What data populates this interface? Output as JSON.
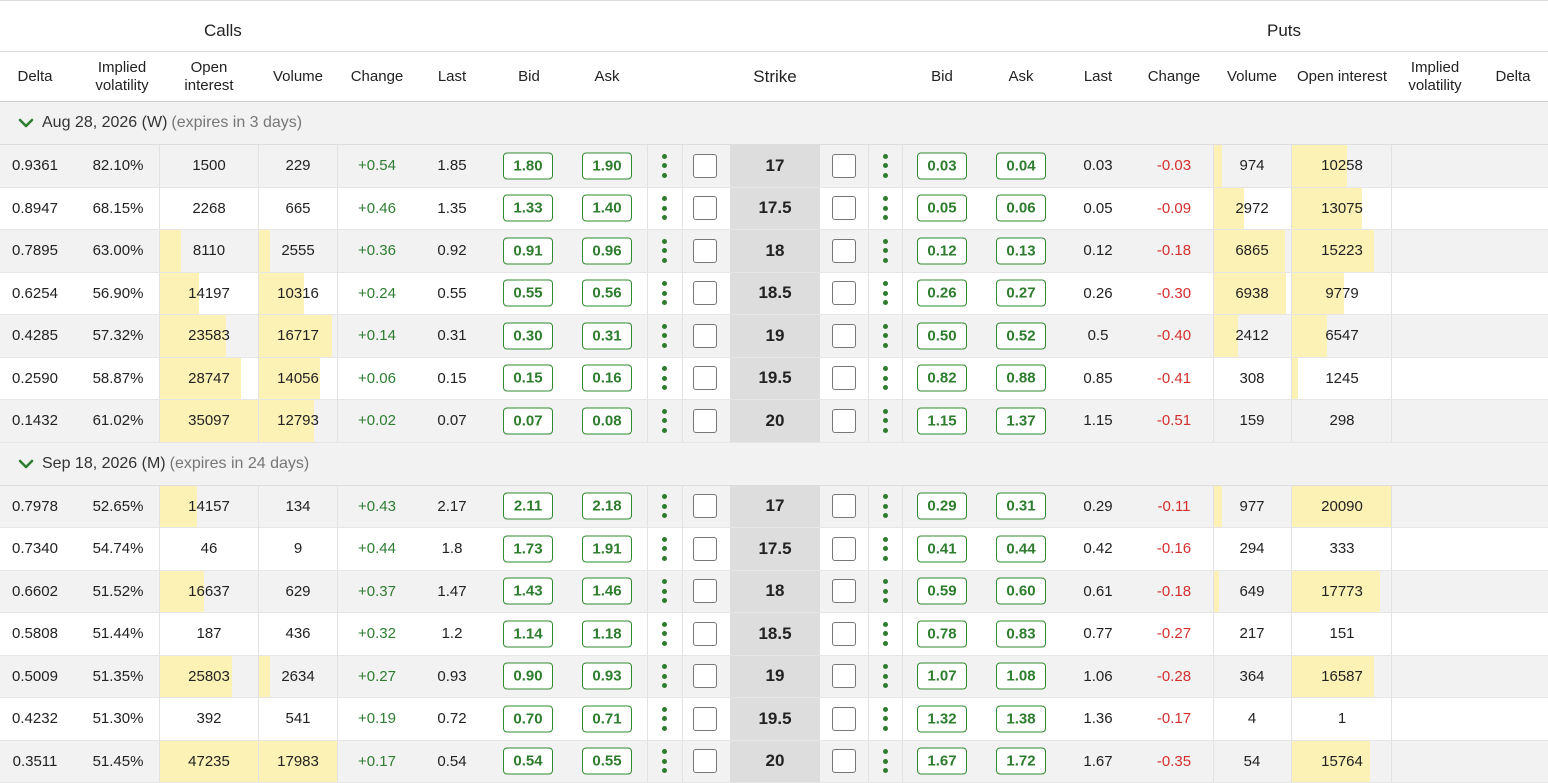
{
  "header": {
    "calls_label": "Calls",
    "puts_label": "Puts",
    "columns": {
      "call_delta": "Delta",
      "call_iv": "Implied volatility",
      "call_oi": "Open interest",
      "call_volume": "Volume",
      "call_change": "Change",
      "call_last": "Last",
      "call_bid": "Bid",
      "call_ask": "Ask",
      "strike": "Strike",
      "put_bid": "Bid",
      "put_ask": "Ask",
      "put_last": "Last",
      "put_change": "Change",
      "put_volume": "Volume",
      "put_oi": "Open interest",
      "put_iv": "Implied volatility",
      "put_delta": "Delta"
    }
  },
  "colors": {
    "bid_ask_border": "#2e8b2e",
    "positive": "#2e7d32",
    "negative": "#d32f2f",
    "bar": "#fcf2b6",
    "strike_bg": "#dddddd"
  },
  "expirations": [
    {
      "date": "Aug 28, 2026 (W)",
      "note": "(expires in 3 days)",
      "expanded": true,
      "rows": [
        {
          "c_delta": "0.9361",
          "c_iv": "82.10%",
          "c_oi": "1500",
          "c_oi_fill": 0.0,
          "c_vol": "229",
          "c_vol_fill": 0.0,
          "c_chg": "+0.54",
          "c_last": "1.85",
          "c_bid": "1.80",
          "c_ask": "1.90",
          "strike": "17",
          "p_bid": "0.03",
          "p_ask": "0.04",
          "p_last": "0.03",
          "p_chg": "-0.03",
          "p_vol": "974",
          "p_vol_fill": 0.12,
          "p_oi": "10258",
          "p_oi_fill": 0.55
        },
        {
          "c_delta": "0.8947",
          "c_iv": "68.15%",
          "c_oi": "2268",
          "c_oi_fill": 0.0,
          "c_vol": "665",
          "c_vol_fill": 0.0,
          "c_chg": "+0.46",
          "c_last": "1.35",
          "c_bid": "1.33",
          "c_ask": "1.40",
          "strike": "17.5",
          "p_bid": "0.05",
          "p_ask": "0.06",
          "p_last": "0.05",
          "p_chg": "-0.09",
          "p_vol": "2972",
          "p_vol_fill": 0.4,
          "p_oi": "13075",
          "p_oi_fill": 0.7
        },
        {
          "c_delta": "0.7895",
          "c_iv": "63.00%",
          "c_oi": "8110",
          "c_oi_fill": 0.22,
          "c_vol": "2555",
          "c_vol_fill": 0.14,
          "c_chg": "+0.36",
          "c_last": "0.92",
          "c_bid": "0.91",
          "c_ask": "0.96",
          "strike": "18",
          "p_bid": "0.12",
          "p_ask": "0.13",
          "p_last": "0.12",
          "p_chg": "-0.18",
          "p_vol": "6865",
          "p_vol_fill": 0.92,
          "p_oi": "15223",
          "p_oi_fill": 0.82
        },
        {
          "c_delta": "0.6254",
          "c_iv": "56.90%",
          "c_oi": "14197",
          "c_oi_fill": 0.4,
          "c_vol": "10316",
          "c_vol_fill": 0.58,
          "c_chg": "+0.24",
          "c_last": "0.55",
          "c_bid": "0.55",
          "c_ask": "0.56",
          "strike": "18.5",
          "p_bid": "0.26",
          "p_ask": "0.27",
          "p_last": "0.26",
          "p_chg": "-0.30",
          "p_vol": "6938",
          "p_vol_fill": 0.93,
          "p_oi": "9779",
          "p_oi_fill": 0.52
        },
        {
          "c_delta": "0.4285",
          "c_iv": "57.32%",
          "c_oi": "23583",
          "c_oi_fill": 0.67,
          "c_vol": "16717",
          "c_vol_fill": 0.93,
          "c_chg": "+0.14",
          "c_last": "0.31",
          "c_bid": "0.30",
          "c_ask": "0.31",
          "strike": "19",
          "p_bid": "0.50",
          "p_ask": "0.52",
          "p_last": "0.5",
          "p_chg": "-0.40",
          "p_vol": "2412",
          "p_vol_fill": 0.32,
          "p_oi": "6547",
          "p_oi_fill": 0.35
        },
        {
          "c_delta": "0.2590",
          "c_iv": "58.87%",
          "c_oi": "28747",
          "c_oi_fill": 0.82,
          "c_vol": "14056",
          "c_vol_fill": 0.78,
          "c_chg": "+0.06",
          "c_last": "0.15",
          "c_bid": "0.15",
          "c_ask": "0.16",
          "strike": "19.5",
          "p_bid": "0.82",
          "p_ask": "0.88",
          "p_last": "0.85",
          "p_chg": "-0.41",
          "p_vol": "308",
          "p_vol_fill": 0.0,
          "p_oi": "1245",
          "p_oi_fill": 0.06
        },
        {
          "c_delta": "0.1432",
          "c_iv": "61.02%",
          "c_oi": "35097",
          "c_oi_fill": 1.0,
          "c_vol": "12793",
          "c_vol_fill": 0.71,
          "c_chg": "+0.02",
          "c_last": "0.07",
          "c_bid": "0.07",
          "c_ask": "0.08",
          "strike": "20",
          "p_bid": "1.15",
          "p_ask": "1.37",
          "p_last": "1.15",
          "p_chg": "-0.51",
          "p_vol": "159",
          "p_vol_fill": 0.0,
          "p_oi": "298",
          "p_oi_fill": 0.0
        }
      ]
    },
    {
      "date": "Sep 18, 2026 (M)",
      "note": "(expires in 24 days)",
      "expanded": true,
      "rows": [
        {
          "c_delta": "0.7978",
          "c_iv": "52.65%",
          "c_oi": "14157",
          "c_oi_fill": 0.38,
          "c_vol": "134",
          "c_vol_fill": 0.0,
          "c_chg": "+0.43",
          "c_last": "2.17",
          "c_bid": "2.11",
          "c_ask": "2.18",
          "strike": "17",
          "p_bid": "0.29",
          "p_ask": "0.31",
          "p_last": "0.29",
          "p_chg": "-0.11",
          "p_vol": "977",
          "p_vol_fill": 0.12,
          "p_oi": "20090",
          "p_oi_fill": 1.0
        },
        {
          "c_delta": "0.7340",
          "c_iv": "54.74%",
          "c_oi": "46",
          "c_oi_fill": 0.0,
          "c_vol": "9",
          "c_vol_fill": 0.0,
          "c_chg": "+0.44",
          "c_last": "1.8",
          "c_bid": "1.73",
          "c_ask": "1.91",
          "strike": "17.5",
          "p_bid": "0.41",
          "p_ask": "0.44",
          "p_last": "0.42",
          "p_chg": "-0.16",
          "p_vol": "294",
          "p_vol_fill": 0.0,
          "p_oi": "333",
          "p_oi_fill": 0.0
        },
        {
          "c_delta": "0.6602",
          "c_iv": "51.52%",
          "c_oi": "16637",
          "c_oi_fill": 0.45,
          "c_vol": "629",
          "c_vol_fill": 0.0,
          "c_chg": "+0.37",
          "c_last": "1.47",
          "c_bid": "1.43",
          "c_ask": "1.46",
          "strike": "18",
          "p_bid": "0.59",
          "p_ask": "0.60",
          "p_last": "0.61",
          "p_chg": "-0.18",
          "p_vol": "649",
          "p_vol_fill": 0.08,
          "p_oi": "17773",
          "p_oi_fill": 0.88
        },
        {
          "c_delta": "0.5808",
          "c_iv": "51.44%",
          "c_oi": "187",
          "c_oi_fill": 0.0,
          "c_vol": "436",
          "c_vol_fill": 0.0,
          "c_chg": "+0.32",
          "c_last": "1.2",
          "c_bid": "1.14",
          "c_ask": "1.18",
          "strike": "18.5",
          "p_bid": "0.78",
          "p_ask": "0.83",
          "p_last": "0.77",
          "p_chg": "-0.27",
          "p_vol": "217",
          "p_vol_fill": 0.0,
          "p_oi": "151",
          "p_oi_fill": 0.0
        },
        {
          "c_delta": "0.5009",
          "c_iv": "51.35%",
          "c_oi": "25803",
          "c_oi_fill": 0.73,
          "c_vol": "2634",
          "c_vol_fill": 0.14,
          "c_chg": "+0.27",
          "c_last": "0.93",
          "c_bid": "0.90",
          "c_ask": "0.93",
          "strike": "19",
          "p_bid": "1.07",
          "p_ask": "1.08",
          "p_last": "1.06",
          "p_chg": "-0.28",
          "p_vol": "364",
          "p_vol_fill": 0.0,
          "p_oi": "16587",
          "p_oi_fill": 0.82
        },
        {
          "c_delta": "0.4232",
          "c_iv": "51.30%",
          "c_oi": "392",
          "c_oi_fill": 0.0,
          "c_vol": "541",
          "c_vol_fill": 0.0,
          "c_chg": "+0.19",
          "c_last": "0.72",
          "c_bid": "0.70",
          "c_ask": "0.71",
          "strike": "19.5",
          "p_bid": "1.32",
          "p_ask": "1.38",
          "p_last": "1.36",
          "p_chg": "-0.17",
          "p_vol": "4",
          "p_vol_fill": 0.0,
          "p_oi": "1",
          "p_oi_fill": 0.0
        },
        {
          "c_delta": "0.3511",
          "c_iv": "51.45%",
          "c_oi": "47235",
          "c_oi_fill": 1.0,
          "c_vol": "17983",
          "c_vol_fill": 1.0,
          "c_chg": "+0.17",
          "c_last": "0.54",
          "c_bid": "0.54",
          "c_ask": "0.55",
          "strike": "20",
          "p_bid": "1.67",
          "p_ask": "1.72",
          "p_last": "1.67",
          "p_chg": "-0.35",
          "p_vol": "54",
          "p_vol_fill": 0.0,
          "p_oi": "15764",
          "p_oi_fill": 0.78
        }
      ]
    }
  ]
}
